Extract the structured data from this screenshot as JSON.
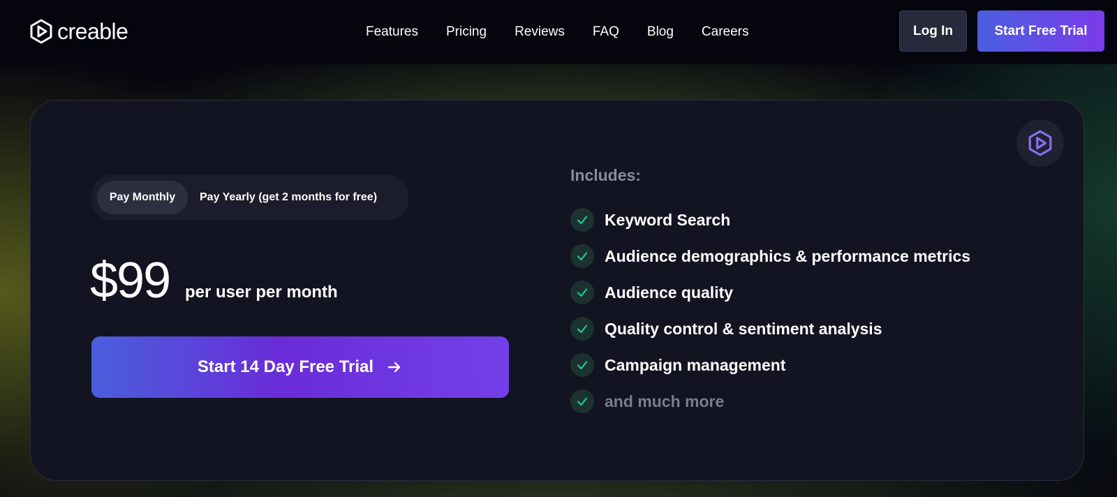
{
  "header": {
    "logo_text": "creable",
    "nav": [
      "Features",
      "Pricing",
      "Reviews",
      "FAQ",
      "Blog",
      "Careers"
    ],
    "login_label": "Log In",
    "trial_label": "Start Free Trial"
  },
  "pricing": {
    "toggle": {
      "monthly_label": "Pay Monthly",
      "yearly_label": "Pay Yearly (get 2 months for free)",
      "selected": "Pay Monthly"
    },
    "price": "$99",
    "price_unit": "per user per month",
    "cta_label": "Start 14 Day Free Trial",
    "includes_title": "Includes:",
    "features": [
      "Keyword Search",
      "Audience demographics & performance metrics",
      "Audience quality",
      "Quality control & sentiment analysis",
      "Campaign management",
      "and much more"
    ]
  },
  "colors": {
    "accent_start": "#4a5fe0",
    "accent_end": "#7a3be8",
    "check": "#22c98a",
    "card_bg": "#121421"
  },
  "icons": {
    "logo": "creable-logo-icon",
    "badge": "creable-badge-icon",
    "check": "check-icon",
    "arrow": "arrow-right-icon"
  }
}
